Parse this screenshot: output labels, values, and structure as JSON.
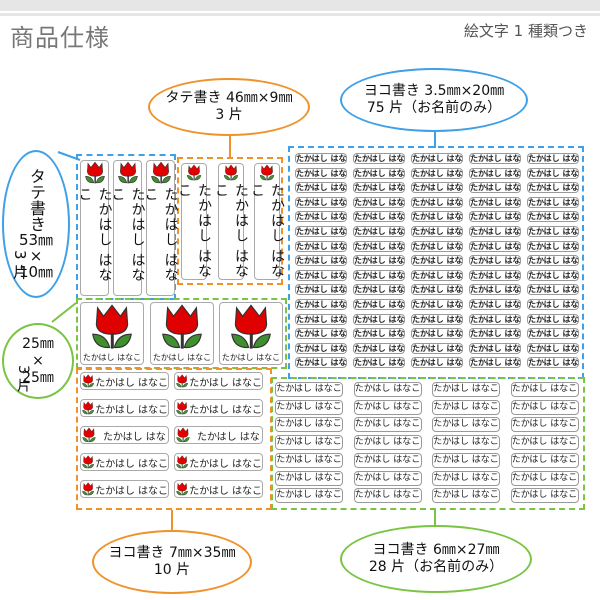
{
  "header": {
    "title": "商品仕様",
    "subtitle": "絵文字 1 種類つき"
  },
  "colors": {
    "blue": "#3ea0e8",
    "orange": "#f0922a",
    "green": "#7ac443",
    "tulip_red": "#e00000",
    "leaf_green": "#3f8f2f"
  },
  "name_text": "たかはし はなこ",
  "name_short": "たかはし はな",
  "labels": {
    "vertical_46x9": {
      "line1": "タテ書き 46㎜×9㎜",
      "line2": "3 片"
    },
    "horizontal_3_5x20": {
      "line1": "ヨコ書き 3.5㎜×20㎜",
      "line2": "75 片（お名前のみ）"
    },
    "vertical_53x10": {
      "line1": "タテ",
      "line2": "書き",
      "line3": "53㎜",
      "line4": "×",
      "line5": "10㎜",
      "count": "3 片"
    },
    "square_25x25": {
      "line1": "25㎜",
      "line2": "×",
      "line3": "25㎜",
      "count": "3 片"
    },
    "horizontal_7x35": {
      "line1": "ヨコ書き 7㎜×35㎜",
      "line2": "10 片"
    },
    "horizontal_6x27": {
      "line1": "ヨコ書き 6㎜×27㎜",
      "line2": "28 片（お名前のみ）"
    }
  },
  "icon": "tulip-icon"
}
